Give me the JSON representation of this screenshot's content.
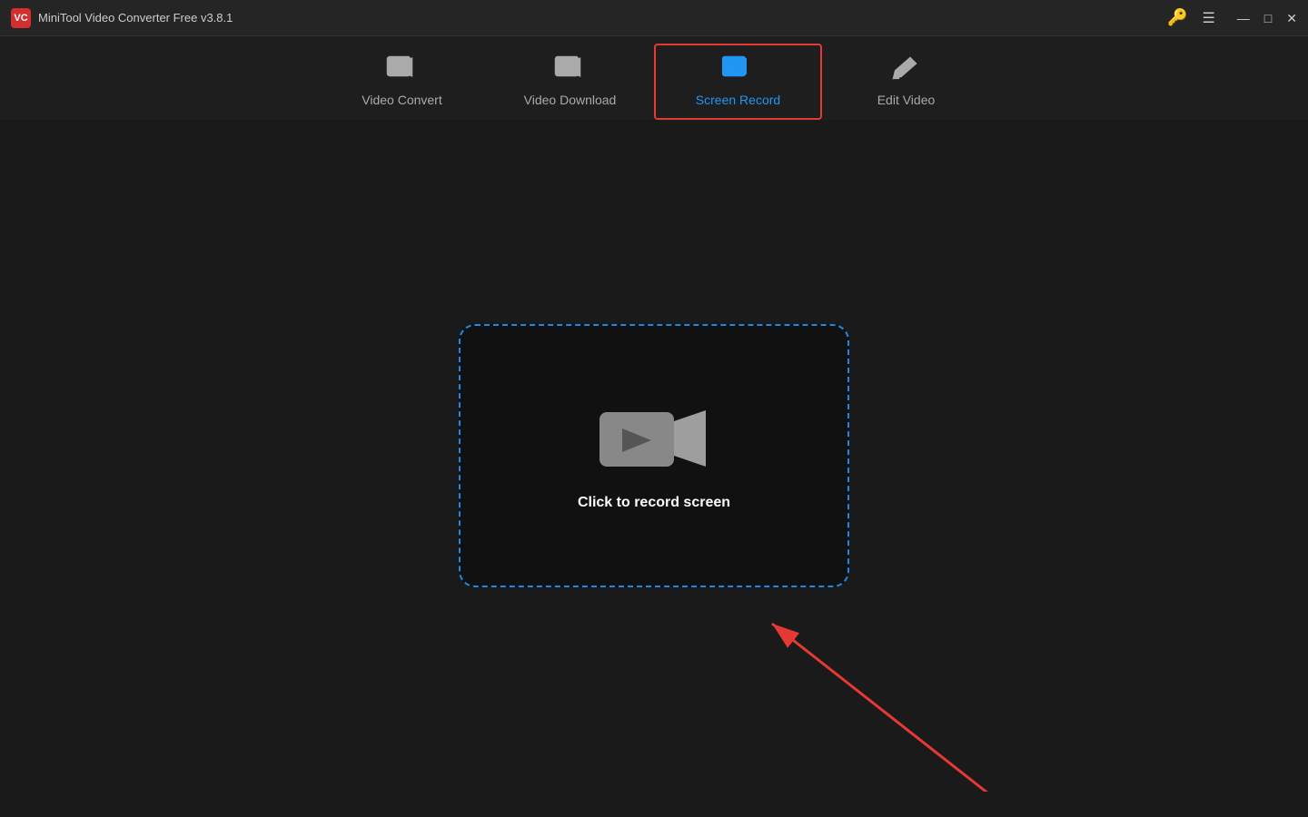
{
  "app": {
    "title": "MiniTool Video Converter Free v3.8.1",
    "logo_text": "VC"
  },
  "nav": {
    "tabs": [
      {
        "id": "video-convert",
        "label": "Video Convert",
        "active": false
      },
      {
        "id": "video-download",
        "label": "Video Download",
        "active": false
      },
      {
        "id": "screen-record",
        "label": "Screen Record",
        "active": true
      },
      {
        "id": "edit-video",
        "label": "Edit Video",
        "active": false
      }
    ]
  },
  "main": {
    "record_area": {
      "click_label": "Click to record screen"
    }
  },
  "window_controls": {
    "minimize": "—",
    "maximize": "□",
    "close": "✕"
  }
}
